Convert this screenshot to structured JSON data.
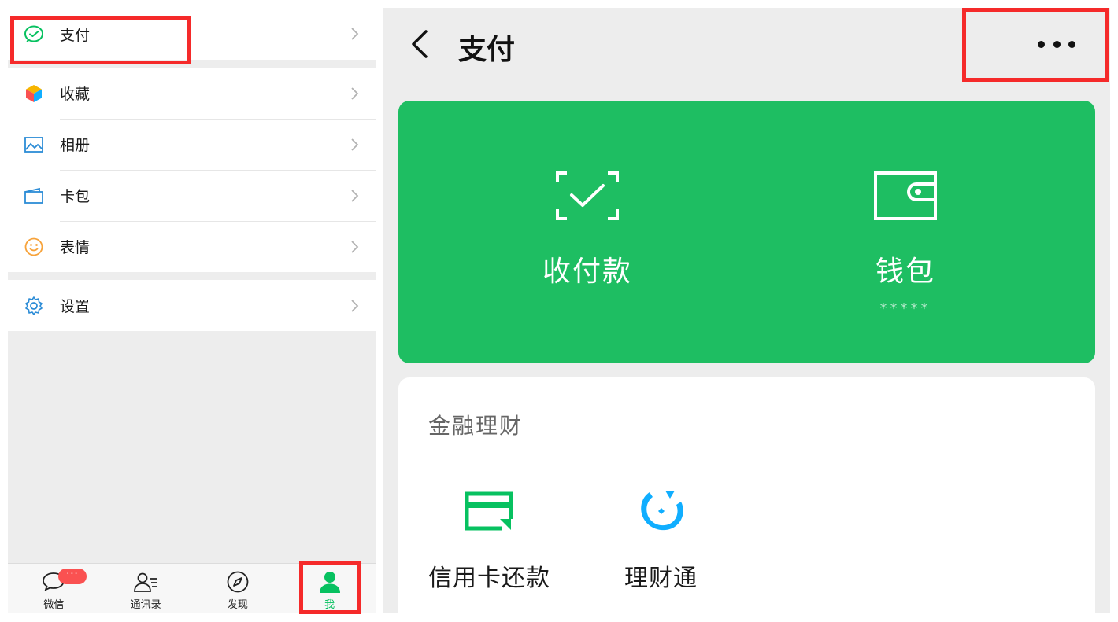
{
  "left_panel": {
    "menu": {
      "pay": {
        "label": "支付"
      },
      "favorites": {
        "label": "收藏"
      },
      "album": {
        "label": "相册"
      },
      "cards": {
        "label": "卡包"
      },
      "stickers": {
        "label": "表情"
      },
      "settings": {
        "label": "设置"
      }
    },
    "tabbar": {
      "chats": {
        "label": "微信",
        "badge": "···"
      },
      "contacts": {
        "label": "通讯录"
      },
      "discover": {
        "label": "发现"
      },
      "me": {
        "label": "我"
      }
    }
  },
  "right_panel": {
    "header": {
      "title": "支付"
    },
    "main_card": {
      "money": {
        "label": "收付款"
      },
      "wallet": {
        "label": "钱包",
        "masked_balance": "*****"
      }
    },
    "finance": {
      "section_title": "金融理财",
      "services": {
        "credit_card": {
          "label": "信用卡还款"
        },
        "wealth": {
          "label": "理财通"
        }
      }
    }
  },
  "colors": {
    "brand_green": "#07c160",
    "card_green": "#1ebe62",
    "highlight_red": "#f52a2a",
    "badge_red": "#fa5151",
    "wealth_blue": "#10aeff"
  },
  "icons": [
    "pay-icon",
    "favorites-icon",
    "album-icon",
    "card-wallet-icon",
    "sticker-icon",
    "settings-gear-icon",
    "chevron-right-icon",
    "chat-bubble-icon",
    "contacts-icon",
    "compass-icon",
    "person-icon",
    "back-arrow-icon",
    "more-dots-icon",
    "scan-check-icon",
    "wallet-icon",
    "credit-card-icon",
    "wealth-icon"
  ]
}
